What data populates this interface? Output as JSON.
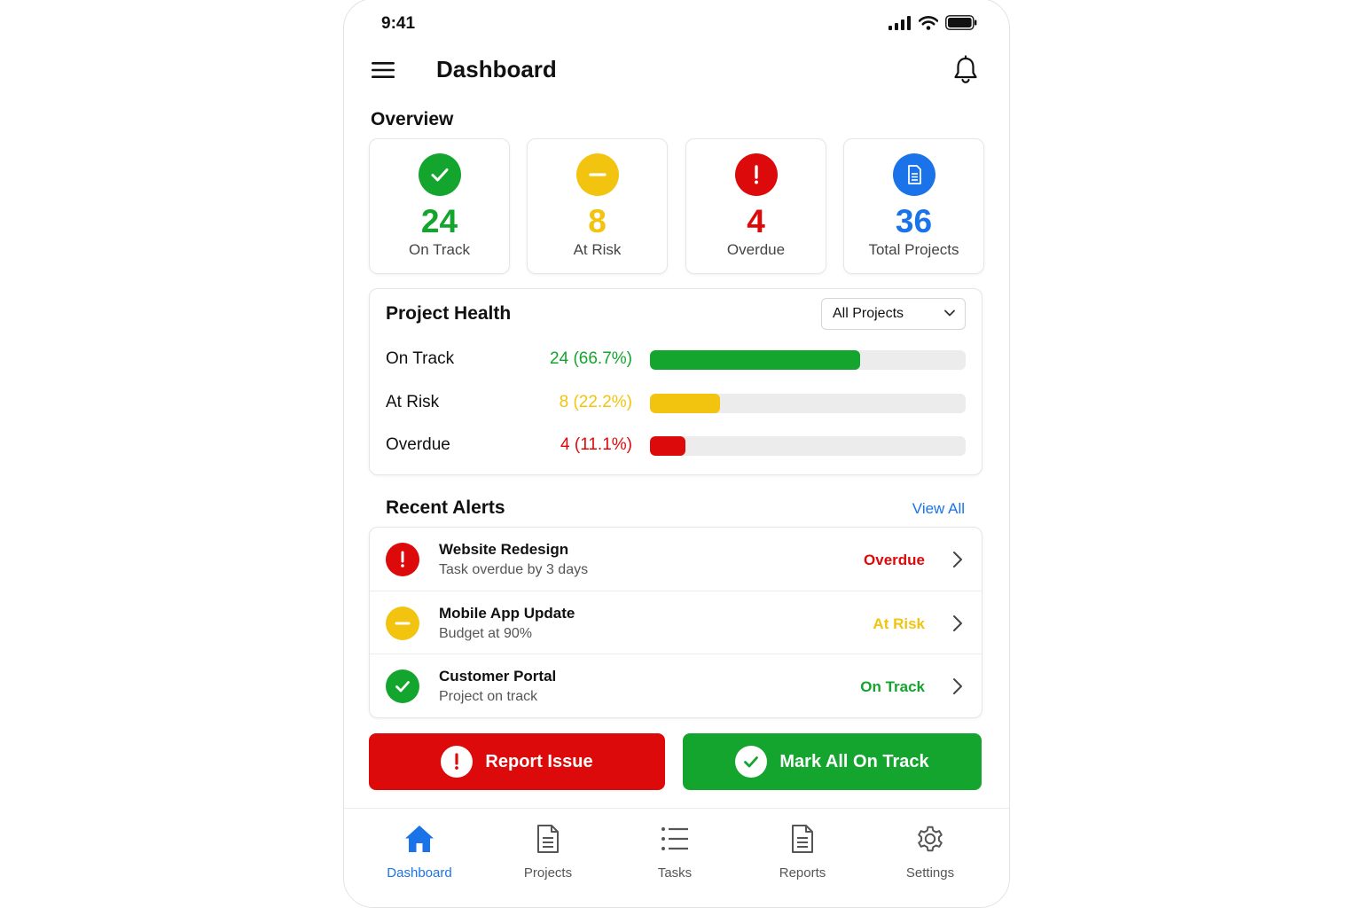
{
  "status_bar": {
    "time": "9:41"
  },
  "header": {
    "title": "Dashboard"
  },
  "overview": {
    "title": "Overview",
    "cards": [
      {
        "value": "24",
        "label": "On Track",
        "color": "#14a52e",
        "icon": "check-icon"
      },
      {
        "value": "8",
        "label": "At Risk",
        "color": "#f2c40f",
        "icon": "minus-icon"
      },
      {
        "value": "4",
        "label": "Overdue",
        "color": "#dc0a0a",
        "icon": "exclamation-icon"
      },
      {
        "value": "36",
        "label": "Total Projects",
        "color": "#1a73e8",
        "icon": "document-icon"
      }
    ]
  },
  "health": {
    "title": "Project Health",
    "filter": "All Projects",
    "rows": [
      {
        "label": "On Track",
        "value": "24 (66.7%)",
        "percent": 66.7,
        "color": "#14a52e"
      },
      {
        "label": "At Risk",
        "value": "8 (22.2%)",
        "percent": 22.2,
        "color": "#f2c40f"
      },
      {
        "label": "Overdue",
        "value": "4 (11.1%)",
        "percent": 11.1,
        "color": "#dc0a0a"
      }
    ]
  },
  "alerts": {
    "title": "Recent Alerts",
    "view_all": "View All",
    "items": [
      {
        "title": "Website Redesign",
        "subtitle": "Task overdue by 3 days",
        "status": "Overdue",
        "color": "#dc0a0a",
        "icon": "exclamation-icon"
      },
      {
        "title": "Mobile App Update",
        "subtitle": "Budget at 90%",
        "status": "At Risk",
        "color": "#f2c40f",
        "icon": "minus-icon"
      },
      {
        "title": "Customer Portal",
        "subtitle": "Project on track",
        "status": "On Track",
        "color": "#14a52e",
        "icon": "check-icon"
      }
    ]
  },
  "actions": {
    "report": "Report Issue",
    "mark": "Mark All On Track"
  },
  "tabbar": {
    "tabs": [
      {
        "label": "Dashboard",
        "icon": "home-icon",
        "active": true
      },
      {
        "label": "Projects",
        "icon": "document-icon"
      },
      {
        "label": "Tasks",
        "icon": "list-icon"
      },
      {
        "label": "Reports",
        "icon": "document-icon"
      },
      {
        "label": "Settings",
        "icon": "gear-icon"
      }
    ]
  },
  "colors": {
    "accent": "#1a73e8",
    "green": "#14a52e",
    "yellow": "#f2c40f",
    "red": "#dc0a0a"
  }
}
